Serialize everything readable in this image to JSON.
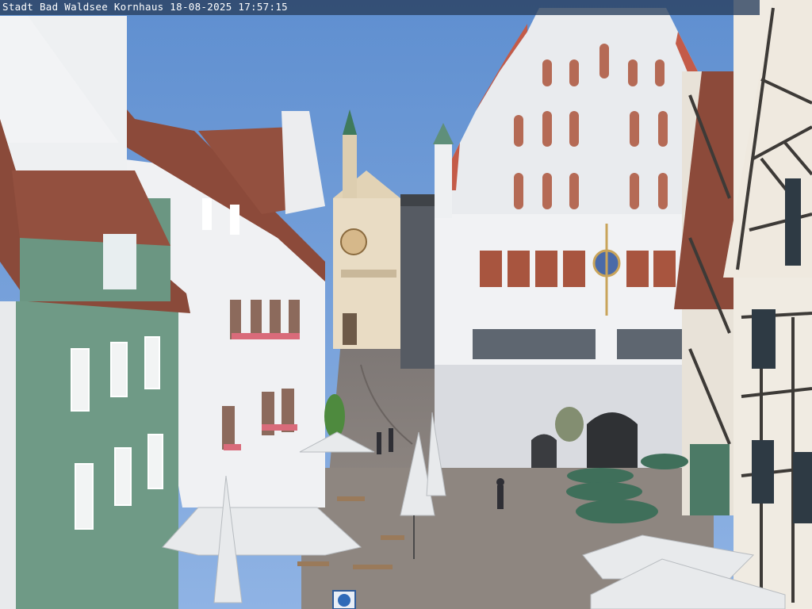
{
  "webcam": {
    "caption": "Stadt Bad Waldsee Kornhaus 18-08-2025 17:57:15"
  },
  "scene": {
    "description_colors": {
      "sky": "#6f9bd6",
      "roof": "#8c4a3a",
      "green_facade": "#6f9a86",
      "plaster": "#eef0f2",
      "umbrella_green": "#3f6f5a",
      "umbrella_white": "#e8eaec",
      "cobble": "#8e8680"
    }
  }
}
